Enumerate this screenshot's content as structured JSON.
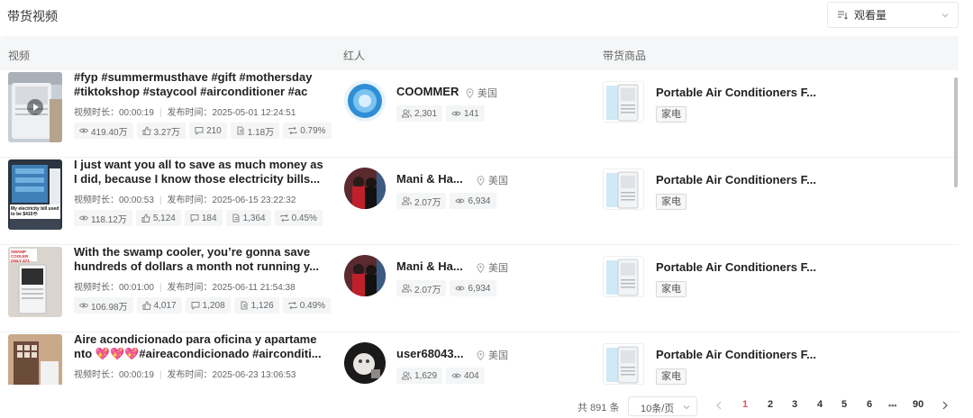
{
  "page_title": "带货视频",
  "sort": {
    "label": "观看量",
    "icon": "sort-lines-icon"
  },
  "columns": {
    "video": "视频",
    "creator": "红人",
    "product": "带货商品"
  },
  "labels": {
    "duration": "视频时长：",
    "published": "发布时间："
  },
  "rows": [
    {
      "title_line1": "#fyp #summermusthave #gift #mothersday",
      "title_line2": "#tiktokshop #staycool #airconditioner #ac",
      "duration": "00:00:19",
      "published": "2025-05-01 12:24:51",
      "views": "419.40万",
      "likes": "3.27万",
      "comments": "210",
      "shares": "1.18万",
      "rate": "0.79%",
      "creator": {
        "name": "COOMMER",
        "country": "美国",
        "followers": "2,301",
        "videos": "141"
      },
      "product": {
        "title": "Portable Air Conditioners F...",
        "tag": "家电"
      }
    },
    {
      "title_line1": "I just want you all to save as much money as",
      "title_line2": "I did, because I know those electricity bills...",
      "duration": "00:00:53",
      "published": "2025-06-15 23:22:32",
      "views": "118.12万",
      "likes": "5,124",
      "comments": "184",
      "shares": "1,364",
      "rate": "0.45%",
      "thumb_caption": "My electricity bill used to be $410😳",
      "creator": {
        "name": "Mani & Ha...",
        "country": "美国",
        "followers": "2.07万",
        "videos": "6,934"
      },
      "product": {
        "title": "Portable Air Conditioners F...",
        "tag": "家电"
      }
    },
    {
      "title_line1": "With the swamp cooler, you’re gonna save",
      "title_line2": "hundreds of dollars a month not running y...",
      "duration": "00:01:00",
      "published": "2025-06-11 21:54:38",
      "views": "106.98万",
      "likes": "4,017",
      "comments": "1,208",
      "shares": "1,126",
      "rate": "0.49%",
      "thumb_caption": "SWAMP COOLER ONLY $71",
      "creator": {
        "name": "Mani & Ha...",
        "country": "美国",
        "followers": "2.07万",
        "videos": "6,934"
      },
      "product": {
        "title": "Portable Air Conditioners F...",
        "tag": "家电"
      }
    },
    {
      "title_line1": "Aire acondicionado para oficina y apartame",
      "title_line2": "nto 💖💖💖#aireacondicionado #airconditi...",
      "duration": "00:00:19",
      "published": "2025-06-23 13:06:53",
      "views": "",
      "likes": "",
      "comments": "",
      "shares": "",
      "rate": "",
      "creator": {
        "name": "user68043...",
        "country": "美国",
        "followers": "1,629",
        "videos": "404"
      },
      "product": {
        "title": "Portable Air Conditioners F...",
        "tag": "家电"
      }
    }
  ],
  "pagination": {
    "total": "共 891 条",
    "page_size": "10条/页",
    "pages": [
      "1",
      "2",
      "3",
      "4",
      "5",
      "6",
      "•••",
      "90"
    ],
    "current": "1"
  },
  "colors": {
    "accent": "#ee4d6a",
    "header_bg": "#f5f6f7",
    "stat_bg": "#f4f5f6"
  }
}
